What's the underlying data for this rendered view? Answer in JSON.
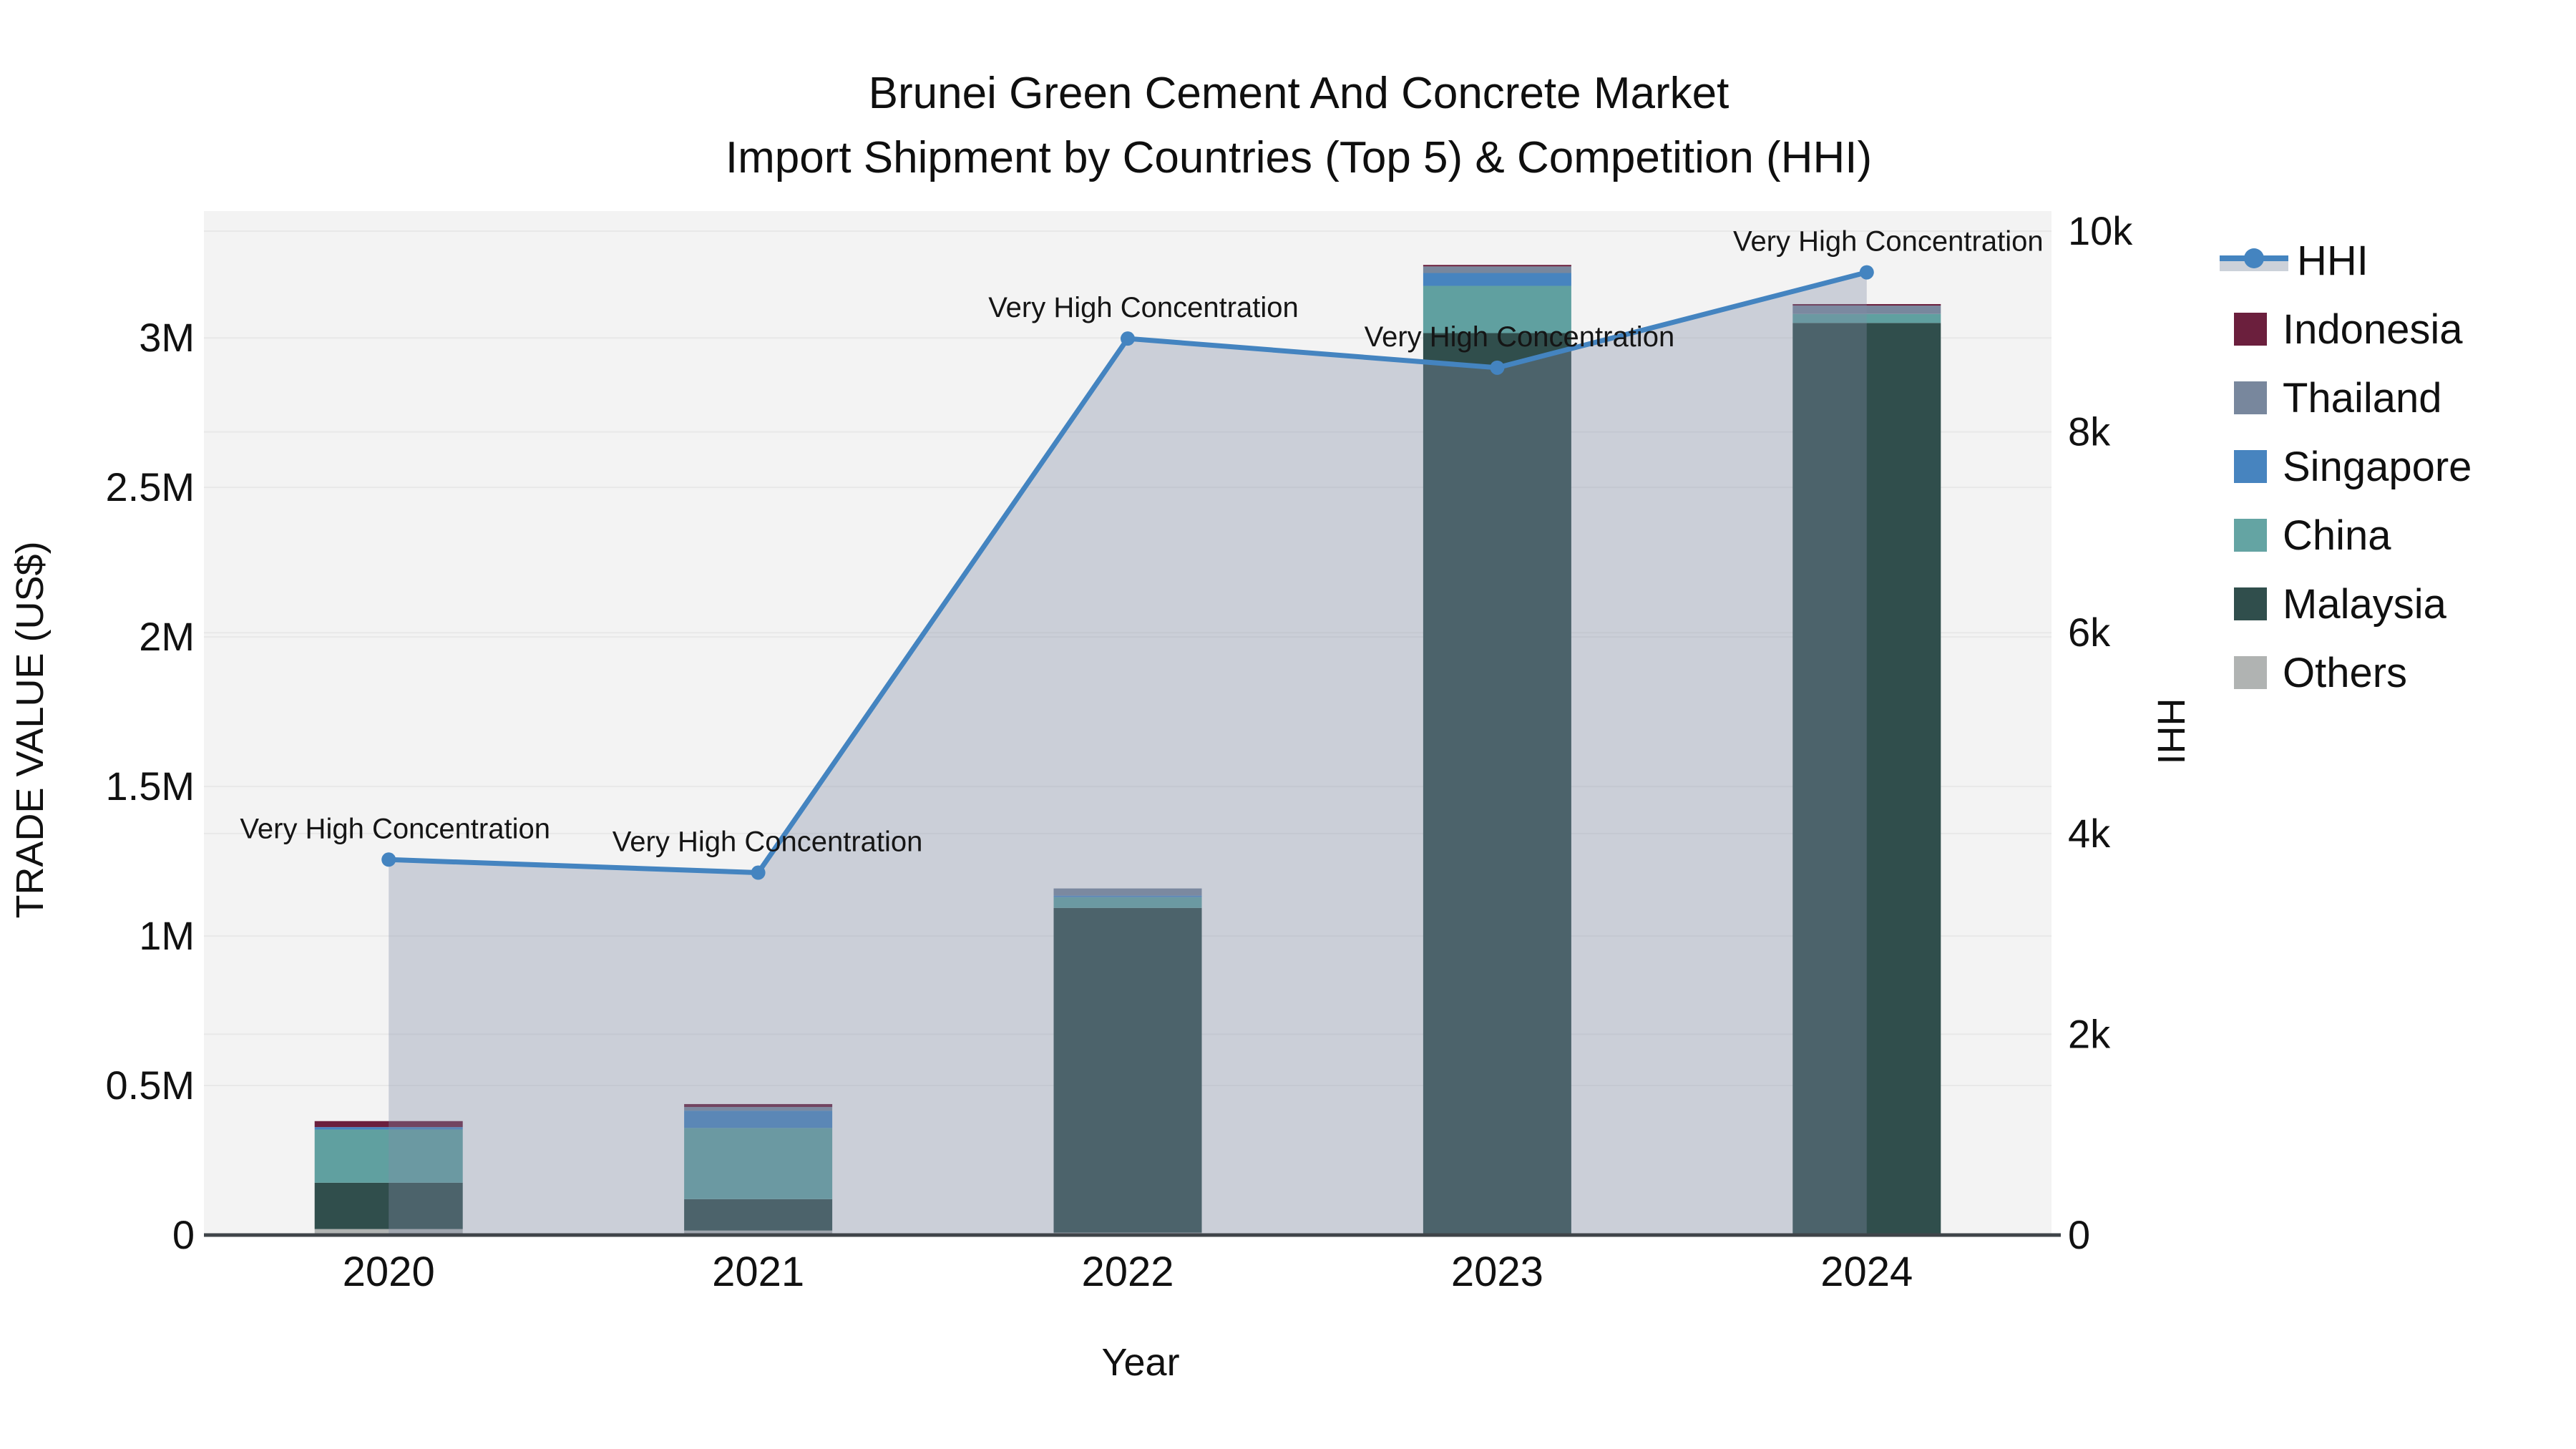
{
  "title": {
    "line1": "Brunei Green Cement And Concrete Market",
    "line2": "Import Shipment by Countries (Top 5) & Competition (HHI)"
  },
  "axes": {
    "x": {
      "title": "Year"
    },
    "y_left": {
      "title": "TRADE VALUE (US$)",
      "tick_labels": [
        "0",
        "0.5M",
        "1M",
        "1.5M",
        "2M",
        "2.5M",
        "3M"
      ],
      "tick_values": [
        0,
        500000,
        1000000,
        1500000,
        2000000,
        2500000,
        3000000
      ]
    },
    "y_right": {
      "title": "HHI",
      "tick_labels": [
        "0",
        "2k",
        "4k",
        "6k",
        "8k",
        "10k"
      ],
      "tick_values": [
        0,
        2000,
        4000,
        6000,
        8000,
        10000
      ]
    }
  },
  "legend": [
    {
      "label": "HHI",
      "type": "line-fill",
      "color": "#4484c0"
    },
    {
      "label": "Indonesia",
      "type": "swatch",
      "color": "#6b1f3d"
    },
    {
      "label": "Thailand",
      "type": "swatch",
      "color": "#78879d"
    },
    {
      "label": "Singapore",
      "type": "swatch",
      "color": "#4784bf"
    },
    {
      "label": "China",
      "type": "swatch",
      "color": "#64a4a3"
    },
    {
      "label": "Malaysia",
      "type": "swatch",
      "color": "#304e4c"
    },
    {
      "label": "Others",
      "type": "swatch",
      "color": "#b0b3b2"
    }
  ],
  "chart_data": {
    "type": "bar+line",
    "subtype": "stacked bars on left axis (trade value US$), HHI line with area fill on right axis",
    "categories": [
      "2020",
      "2021",
      "2022",
      "2023",
      "2024"
    ],
    "bar_series_bottom_to_top": [
      {
        "name": "Others",
        "color": "#b0b3b2",
        "values": [
          20000,
          15000,
          8000,
          6000,
          6000
        ]
      },
      {
        "name": "Malaysia",
        "color": "#304e4c",
        "values": [
          155000,
          105000,
          1086000,
          3010000,
          3044000
        ]
      },
      {
        "name": "China",
        "color": "#60a0a0",
        "values": [
          178000,
          238000,
          36000,
          158000,
          30000
        ]
      },
      {
        "name": "Singapore",
        "color": "#4784bf",
        "values": [
          8000,
          58000,
          5000,
          43000,
          0
        ]
      },
      {
        "name": "Thailand",
        "color": "#78879d",
        "values": [
          0,
          12000,
          24000,
          22000,
          28000
        ]
      },
      {
        "name": "Indonesia",
        "color": "#6b1f3d",
        "values": [
          20000,
          10000,
          0,
          5000,
          5000
        ]
      }
    ],
    "bar_totals": [
      381000,
      438000,
      1159000,
      3244000,
      3113000
    ],
    "line_series": {
      "name": "HHI",
      "axis": "right",
      "color": "#4484c0",
      "values": [
        3740,
        3610,
        8930,
        8640,
        9590
      ]
    },
    "annotations": [
      "Very High Concentration",
      "Very High Concentration",
      "Very High Concentration",
      "Very High Concentration",
      "Very High Concentration"
    ],
    "ylim_left": [
      0,
      3424000
    ],
    "ylim_right": [
      0,
      10200
    ],
    "grid": true,
    "legend_position": "right"
  },
  "colors": {
    "plot_bg": "#f3f3f3",
    "grid": "#e8e8e8",
    "axis_line": "#3f4449",
    "hhi_fill": "rgba(128,140,166,0.35)",
    "text": "#111111",
    "annotation_text": "#151515"
  }
}
